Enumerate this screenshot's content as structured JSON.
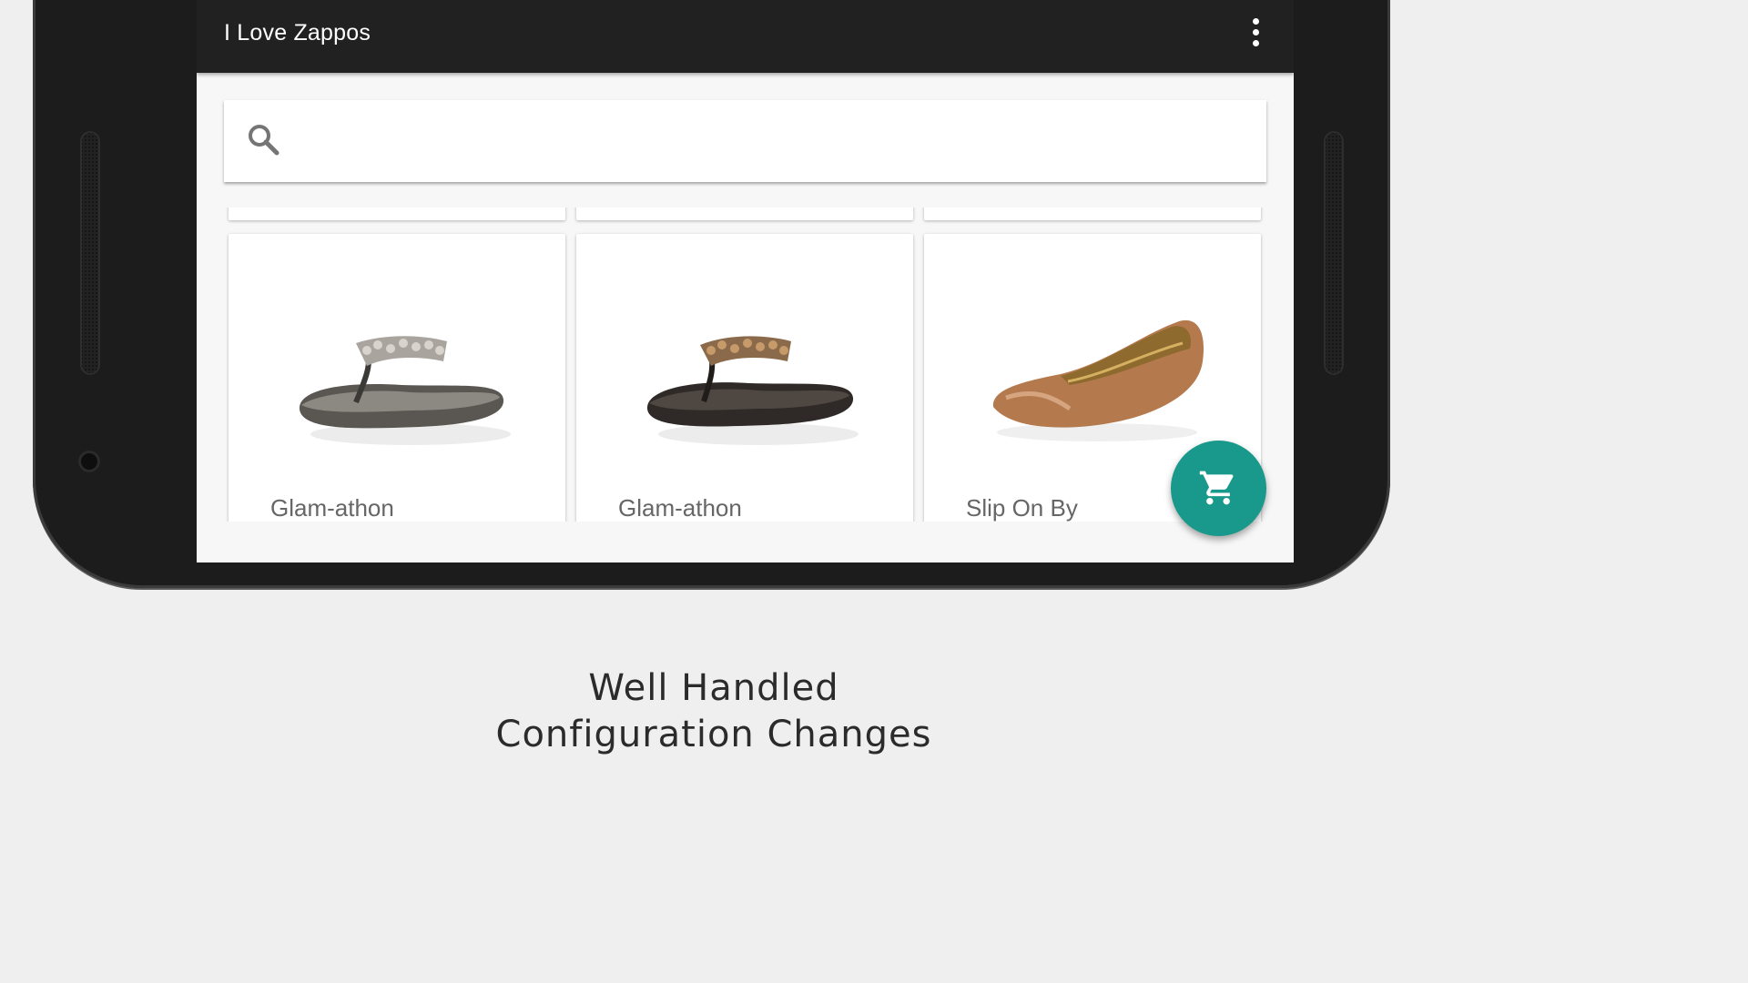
{
  "app": {
    "title": "I Love Zappos"
  },
  "search": {
    "placeholder": ""
  },
  "products": [
    {
      "name": "Glam-athon",
      "image": "silver-flip-flop-image"
    },
    {
      "name": "Glam-athon",
      "image": "bronze-flip-flop-image"
    },
    {
      "name": "Slip On By",
      "image": "tan-ballet-flat-image"
    }
  ],
  "fab": {
    "icon": "shopping-cart-icon",
    "color": "#18998b"
  },
  "caption": {
    "line1": "Well Handled",
    "line2": "Configuration Changes"
  },
  "colors": {
    "appbar": "#212121",
    "background": "#efefef",
    "accent": "#18998b"
  }
}
